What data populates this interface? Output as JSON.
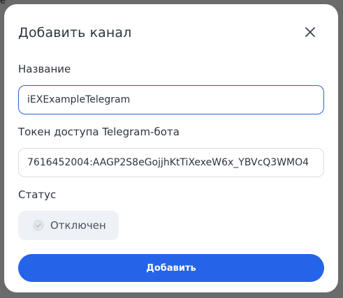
{
  "background_glyph": "e",
  "modal": {
    "title": "Добавить канал",
    "close_icon": "close-icon",
    "fields": {
      "name": {
        "label": "Название",
        "value": "iEXExampleTelegram"
      },
      "token": {
        "label": "Токен доступа Telegram-бота",
        "value": "7616452004:AAGP2S8eGojjhKtTiXexeW6x_YBVcQ3WMO4"
      },
      "status": {
        "label": "Статус",
        "value": "Отключен",
        "icon": "check-circle-icon"
      }
    },
    "submit_label": "Добавить"
  },
  "colors": {
    "accent": "#2563e8",
    "focus_border": "#2f5fd6",
    "text": "#2b3440",
    "toggle_bg": "#eef1f5",
    "overlay": "#6b6b6b"
  }
}
